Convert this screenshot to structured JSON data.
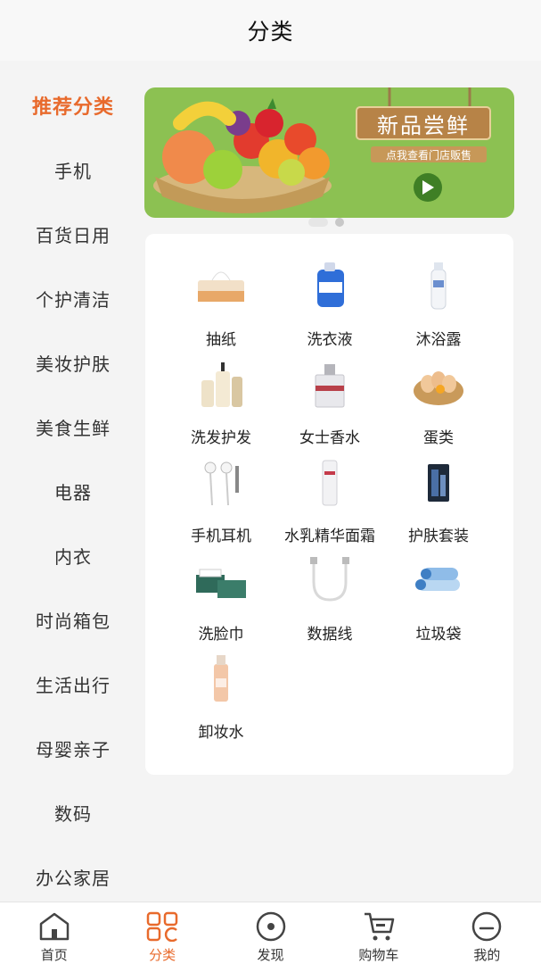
{
  "header": {
    "title": "分类"
  },
  "sidebar": {
    "items": [
      {
        "label": "推荐分类",
        "active": true
      },
      {
        "label": "手机"
      },
      {
        "label": "百货日用"
      },
      {
        "label": "个护清洁"
      },
      {
        "label": "美妆护肤"
      },
      {
        "label": "美食生鲜"
      },
      {
        "label": "电器"
      },
      {
        "label": "内衣"
      },
      {
        "label": "时尚箱包"
      },
      {
        "label": "生活出行"
      },
      {
        "label": "母婴亲子"
      },
      {
        "label": "数码"
      },
      {
        "label": "办公家居"
      }
    ]
  },
  "banner": {
    "title": "新品尝鲜",
    "subtitle": "点我查看门店贩售",
    "background": "#8cc152",
    "slides": 2,
    "active_slide": 0
  },
  "categories": [
    {
      "label": "抽纸",
      "icon": "tissue-box-icon"
    },
    {
      "label": "洗衣液",
      "icon": "laundry-detergent-icon"
    },
    {
      "label": "沐浴露",
      "icon": "body-wash-icon"
    },
    {
      "label": "洗发护发",
      "icon": "shampoo-icon"
    },
    {
      "label": "女士香水",
      "icon": "perfume-icon"
    },
    {
      "label": "蛋类",
      "icon": "eggs-icon"
    },
    {
      "label": "手机耳机",
      "icon": "earphones-icon"
    },
    {
      "label": "水乳精华面霜",
      "icon": "skincare-bottle-icon"
    },
    {
      "label": "护肤套装",
      "icon": "skincare-set-icon"
    },
    {
      "label": "洗脸巾",
      "icon": "face-towel-icon"
    },
    {
      "label": "数据线",
      "icon": "data-cable-icon"
    },
    {
      "label": "垃圾袋",
      "icon": "trash-bag-icon"
    },
    {
      "label": "卸妆水",
      "icon": "makeup-remover-icon"
    }
  ],
  "tabbar": {
    "items": [
      {
        "label": "首页",
        "icon": "home-icon"
      },
      {
        "label": "分类",
        "icon": "category-grid-icon",
        "active": true
      },
      {
        "label": "发现",
        "icon": "discover-icon"
      },
      {
        "label": "购物车",
        "icon": "cart-icon"
      },
      {
        "label": "我的",
        "icon": "profile-icon"
      }
    ]
  },
  "colors": {
    "accent": "#e86a2c",
    "banner_green": "#8cc152",
    "panel": "#ffffff",
    "background": "#f4f4f4"
  }
}
